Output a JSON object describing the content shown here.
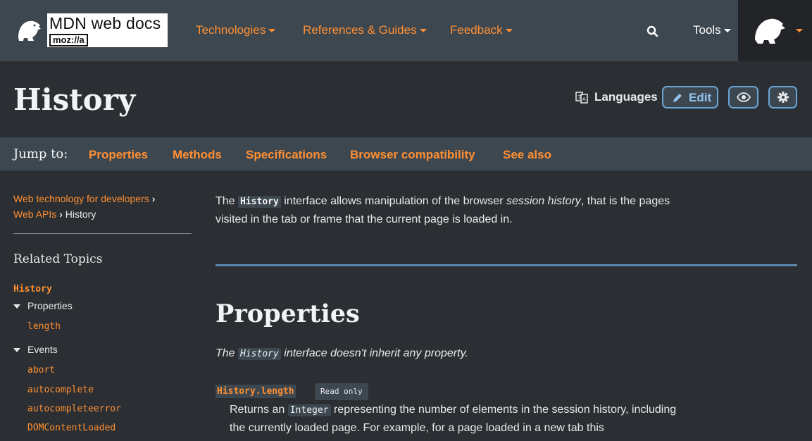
{
  "header": {
    "logo_title": "MDN web docs",
    "logo_sub": "moz://a",
    "nav": [
      {
        "label": "Technologies"
      },
      {
        "label": "References & Guides"
      },
      {
        "label": "Feedback"
      }
    ],
    "tools_label": "Tools",
    "accent": "#ff8f32"
  },
  "page": {
    "title": "History",
    "languages_label": "Languages",
    "edit_label": "Edit"
  },
  "jump": {
    "label": "Jump to:",
    "links": [
      "Properties",
      "Methods",
      "Specifications",
      "Browser compatibility",
      "See also"
    ]
  },
  "sidebar": {
    "breadcrumb": {
      "root": "Web technology for developers",
      "parent": "Web APIs",
      "current": "History",
      "separator": "›"
    },
    "related_title": "Related Topics",
    "topic": "History",
    "groups": [
      {
        "label": "Properties",
        "items": [
          "length"
        ]
      },
      {
        "label": "Events",
        "items": [
          "abort",
          "autocomplete",
          "autocompleteerror",
          "DOMContentLoaded"
        ]
      }
    ]
  },
  "content": {
    "intro": {
      "pre": "The ",
      "code": "History",
      "mid": " interface allows manipulation of the browser ",
      "em": "session history",
      "post": ", that is the pages visited in the tab or frame that the current page is loaded in."
    },
    "properties_heading": "Properties",
    "inherit": {
      "pre": "The ",
      "code": "History",
      "post": " interface doesn't inherit any property."
    },
    "property": {
      "name": "History.length",
      "badge": "Read only",
      "desc_pre": "Returns an ",
      "desc_code": "Integer",
      "desc_post": " representing the number of elements in the session history, including the currently loaded page. For example, for a page loaded in a new tab this"
    }
  }
}
